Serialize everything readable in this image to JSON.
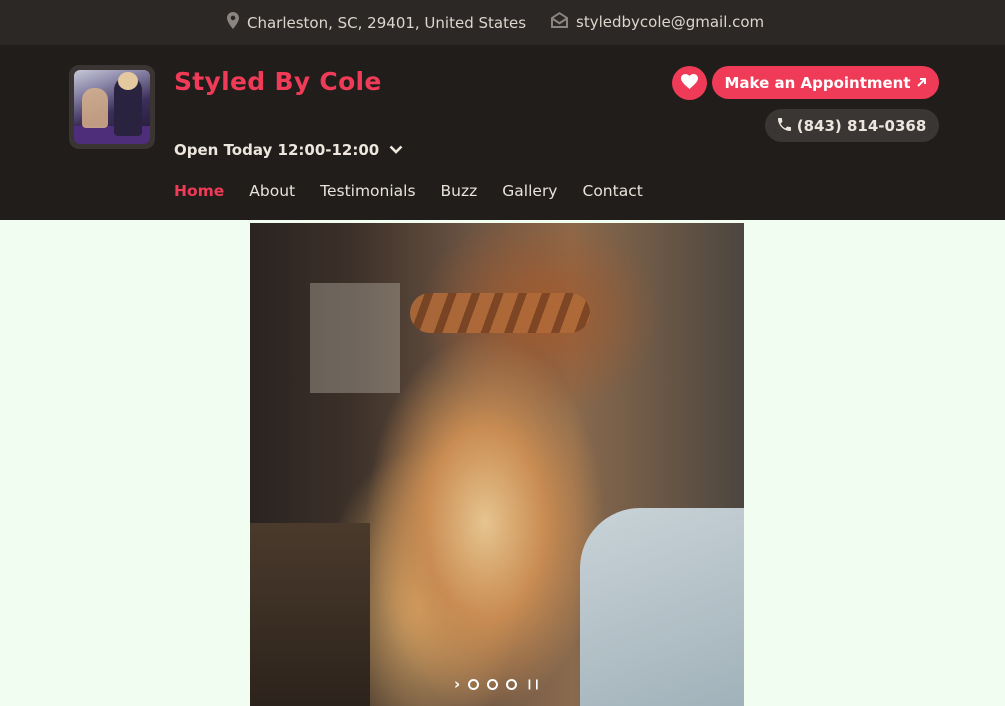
{
  "topbar": {
    "address": "Charleston, SC, 29401, United States",
    "email": "styledbycole@gmail.com"
  },
  "header": {
    "brand": "Styled By Cole",
    "hours": "Open Today 12:00-12:00",
    "appointment_label": "Make an Appointment",
    "phone": "(843) 814-0368"
  },
  "nav": {
    "items": [
      {
        "label": "Home",
        "active": true
      },
      {
        "label": "About"
      },
      {
        "label": "Testimonials"
      },
      {
        "label": "Buzz"
      },
      {
        "label": "Gallery"
      },
      {
        "label": "Contact"
      }
    ]
  },
  "slider": {
    "slide_count": 3,
    "current_slide": 1
  },
  "colors": {
    "accent": "#ef3b57",
    "header_bg": "#201d1b",
    "topbar_bg": "#2b2826",
    "page_bg": "#f2fdf1"
  }
}
